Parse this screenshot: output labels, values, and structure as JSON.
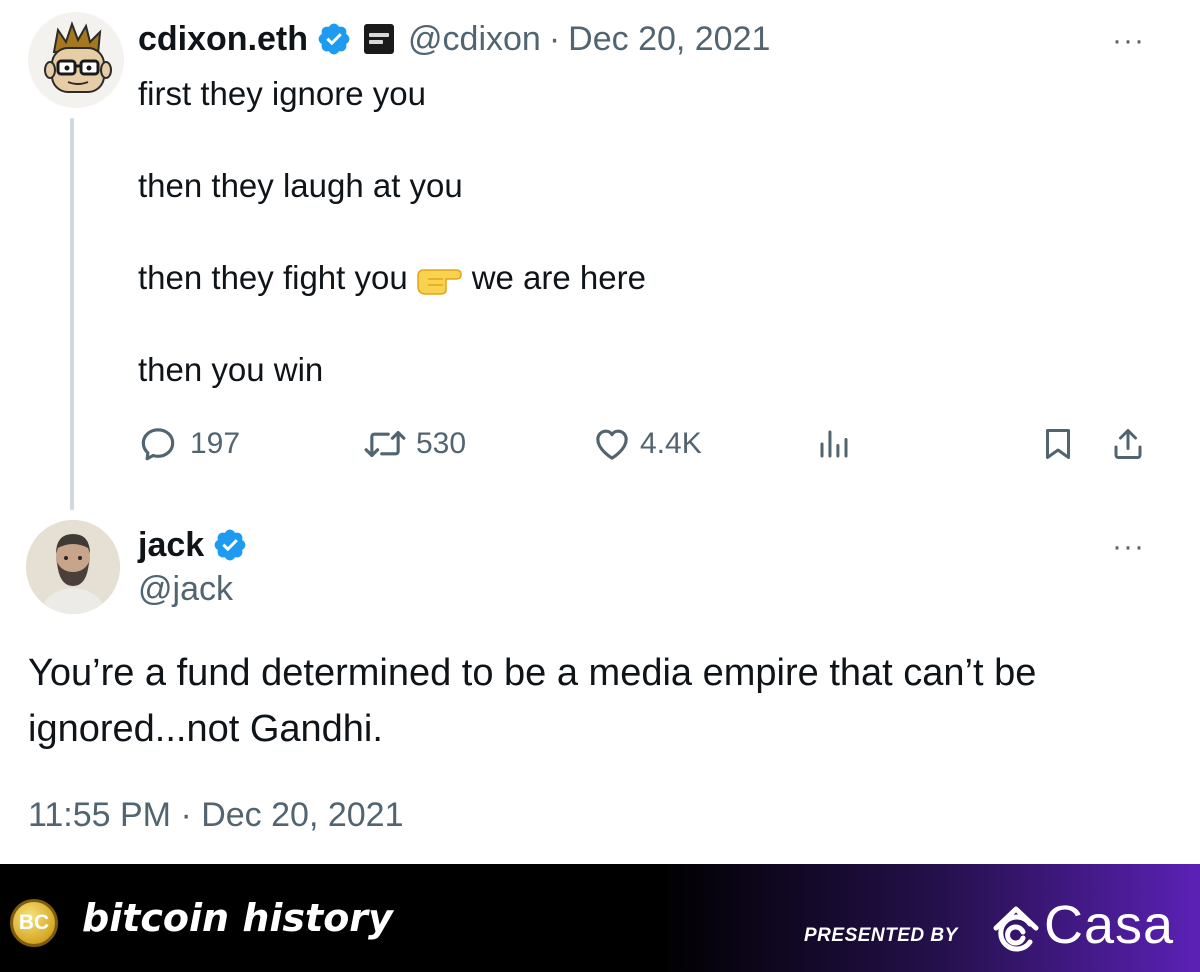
{
  "tweet1": {
    "name": "cdixon.eth",
    "handle": "@cdixon",
    "separator": "·",
    "date": "Dec 20, 2021",
    "more": "···",
    "lines": [
      "first they ignore you",
      "then they laugh at you",
      "then they fight you",
      "we are here",
      "then you win"
    ],
    "point_emoji": "pointing-right-emoji",
    "stats": {
      "replies": "197",
      "retweets": "530",
      "likes": "4.4K"
    },
    "icons": [
      "reply-icon",
      "retweet-icon",
      "like-icon",
      "views-icon",
      "bookmark-icon",
      "share-icon"
    ]
  },
  "tweet2": {
    "name": "jack",
    "handle": "@jack",
    "more": "···",
    "text": "You’re a fund determined to be a media empire that can’t be ignored...not Gandhi.",
    "timestamp": "11:55 PM · Dec 20, 2021"
  },
  "footer": {
    "coin_text": "BC",
    "title": "bitcoin history",
    "presented_by": "PRESENTED BY",
    "brand": "Casa"
  },
  "colors": {
    "verified": "#1d9bf0",
    "text": "#0f1419",
    "secondary": "#536471",
    "thread_line": "#cfd9de",
    "footer_accent": "#5b21b6"
  }
}
